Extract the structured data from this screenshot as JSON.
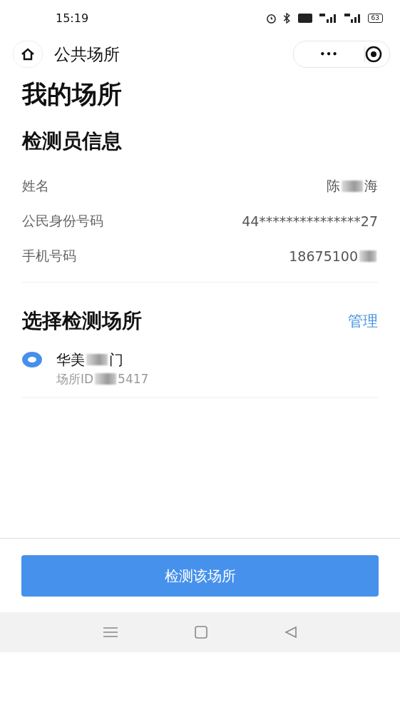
{
  "status_bar": {
    "time": "15:19",
    "battery": "63"
  },
  "nav": {
    "title": "公共场所",
    "more": "•••"
  },
  "page_title": "我的场所",
  "inspector": {
    "heading": "检测员信息",
    "rows": [
      {
        "label": "姓名",
        "value_parts": [
          "陈",
          "海"
        ]
      },
      {
        "label": "公民身份号码",
        "value_parts": [
          "44***************27"
        ]
      },
      {
        "label": "手机号码",
        "value_parts": [
          "18675100"
        ]
      }
    ]
  },
  "places": {
    "heading": "选择检测场所",
    "manage": "管理",
    "items": [
      {
        "name_parts": [
          "华美",
          "门"
        ],
        "id_parts": [
          "场所ID",
          "5417"
        ],
        "selected": true
      }
    ]
  },
  "action_button": "检测该场所"
}
